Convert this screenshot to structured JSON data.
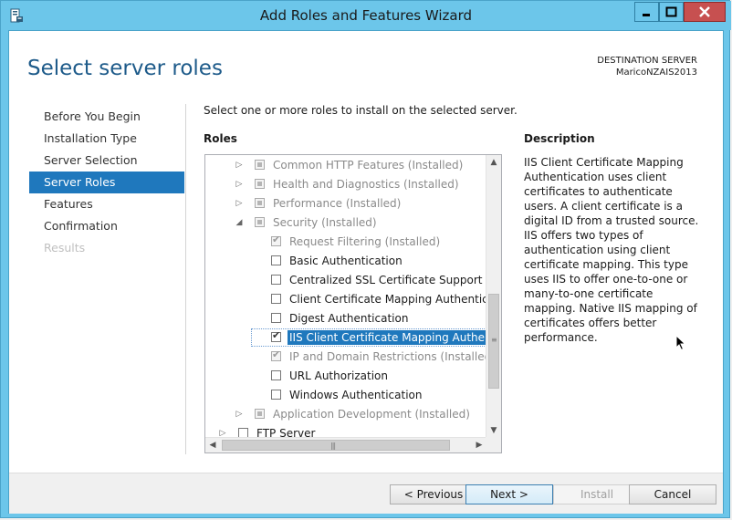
{
  "window": {
    "title": "Add Roles and Features Wizard"
  },
  "page": {
    "title": "Select server roles",
    "destination_label": "DESTINATION SERVER",
    "destination_server": "MaricoNZAIS2013"
  },
  "nav": {
    "items": [
      {
        "label": "Before You Begin",
        "state": "normal"
      },
      {
        "label": "Installation Type",
        "state": "normal"
      },
      {
        "label": "Server Selection",
        "state": "normal"
      },
      {
        "label": "Server Roles",
        "state": "active"
      },
      {
        "label": "Features",
        "state": "normal"
      },
      {
        "label": "Confirmation",
        "state": "normal"
      },
      {
        "label": "Results",
        "state": "disabled"
      }
    ]
  },
  "main": {
    "instruction": "Select one or more roles to install on the selected server.",
    "roles_heading": "Roles",
    "description_heading": "Description",
    "description": "IIS Client Certificate Mapping Authentication uses client certificates to authenticate users. A client certificate is a digital ID from a trusted source. IIS offers two types of authentication using client certificate mapping. This type uses IIS to offer one-to-one or many-to-one certificate mapping. Native IIS mapping of certificates offers better performance."
  },
  "roles": [
    {
      "label": "Common HTTP Features (Installed)"
    },
    {
      "label": "Health and Diagnostics (Installed)"
    },
    {
      "label": "Performance (Installed)"
    },
    {
      "label": "Security (Installed)"
    },
    {
      "label": "Request Filtering (Installed)"
    },
    {
      "label": "Basic Authentication"
    },
    {
      "label": "Centralized SSL Certificate Support"
    },
    {
      "label": "Client Certificate Mapping Authentication"
    },
    {
      "label": "Digest Authentication"
    },
    {
      "label": "IIS Client Certificate Mapping Authentication"
    },
    {
      "label": "IP and Domain Restrictions (Installed)"
    },
    {
      "label": "URL Authorization"
    },
    {
      "label": "Windows Authentication"
    },
    {
      "label": "Application Development (Installed)"
    },
    {
      "label": "FTP Server"
    }
  ],
  "footer": {
    "previous": "< Previous",
    "next": "Next >",
    "install": "Install",
    "cancel": "Cancel"
  },
  "icons": {
    "app": "server-manager-icon",
    "minimize": "minimize-icon",
    "maximize": "maximize-icon",
    "close": "close-icon",
    "cursor": "mouse-pointer-icon"
  },
  "colors": {
    "title_bar": "#6cc6ea",
    "accent": "#1f78bd",
    "page_title": "#1e5b8a",
    "close_button": "#c75050"
  }
}
